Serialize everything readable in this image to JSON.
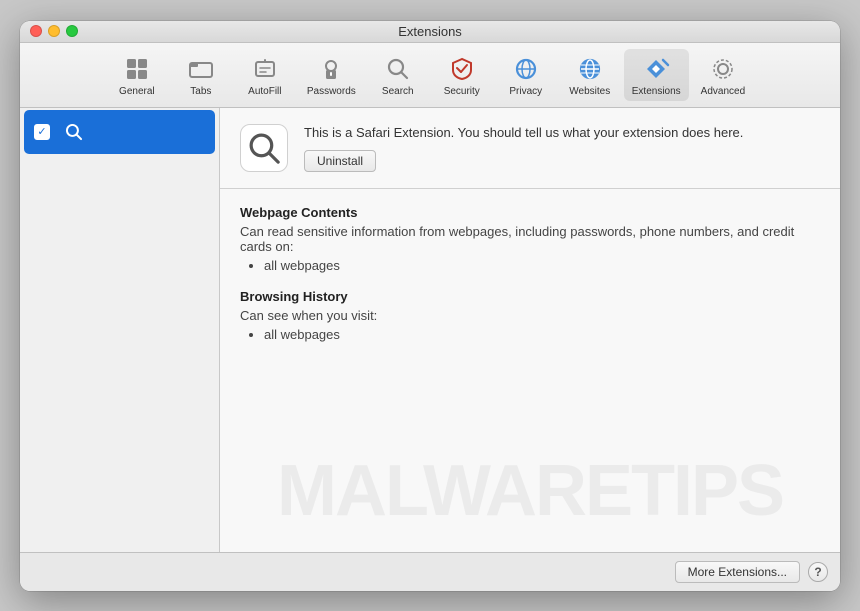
{
  "window": {
    "title": "Extensions"
  },
  "toolbar": {
    "items": [
      {
        "id": "general",
        "label": "General",
        "icon": "general"
      },
      {
        "id": "tabs",
        "label": "Tabs",
        "icon": "tabs"
      },
      {
        "id": "autofill",
        "label": "AutoFill",
        "icon": "autofill"
      },
      {
        "id": "passwords",
        "label": "Passwords",
        "icon": "passwords"
      },
      {
        "id": "search",
        "label": "Search",
        "icon": "search"
      },
      {
        "id": "security",
        "label": "Security",
        "icon": "security"
      },
      {
        "id": "privacy",
        "label": "Privacy",
        "icon": "privacy"
      },
      {
        "id": "websites",
        "label": "Websites",
        "icon": "websites"
      },
      {
        "id": "extensions",
        "label": "Extensions",
        "icon": "extensions",
        "active": true
      },
      {
        "id": "advanced",
        "label": "Advanced",
        "icon": "advanced"
      }
    ]
  },
  "sidebar": {
    "items": [
      {
        "id": "search-ext",
        "label": "",
        "checked": true,
        "selected": true
      }
    ]
  },
  "detail": {
    "extension": {
      "description": "This is a Safari Extension. You should tell us what your extension does here.",
      "uninstall_label": "Uninstall"
    },
    "permissions": [
      {
        "title": "Webpage Contents",
        "description": "Can read sensitive information from webpages, including passwords, phone numbers, and credit cards on:",
        "items": [
          "all webpages"
        ]
      },
      {
        "title": "Browsing History",
        "description": "Can see when you visit:",
        "items": [
          "all webpages"
        ]
      }
    ]
  },
  "footer": {
    "more_extensions_label": "More Extensions...",
    "help_label": "?"
  },
  "watermark": {
    "text": "MALWARETIPS"
  }
}
